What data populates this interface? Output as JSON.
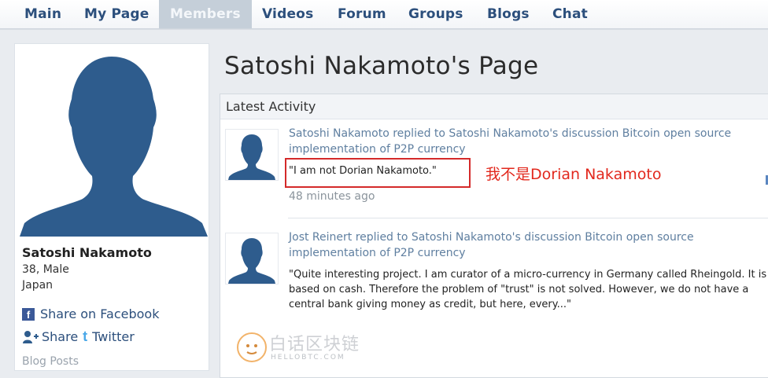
{
  "nav": {
    "items": [
      "Main",
      "My Page",
      "Members",
      "Videos",
      "Forum",
      "Groups",
      "Blogs",
      "Chat"
    ],
    "active": "Members"
  },
  "profile": {
    "name": "Satoshi Nakamoto",
    "age_gender": "38, Male",
    "location": "Japan",
    "share_facebook": "Share on Facebook",
    "share_label": "Share",
    "twitter_label": "Twitter",
    "blog_posts": "Blog Posts"
  },
  "page": {
    "title": "Satoshi Nakamoto's Page"
  },
  "activity": {
    "header": "Latest Activity",
    "items": [
      {
        "summary": "Satoshi Nakamoto replied to Satoshi Nakamoto's discussion Bitcoin open source implementation of P2P currency",
        "quote": "\"I am not Dorian Nakamoto.\"",
        "time": "48 minutes ago"
      },
      {
        "summary": "Jost Reinert replied to Satoshi Nakamoto's discussion Bitcoin open source implementation of P2P currency",
        "quote": "\"Quite interesting project. I am curator of a micro-currency in Germany called Rheingold. It is based on cash. Therefore the problem of \"trust\" is not solved. However, we do not have a central bank giving money as credit, but here, every...\""
      }
    ]
  },
  "annotation": {
    "text": "我不是Dorian Nakamoto",
    "color": "#e2281d"
  },
  "watermark": {
    "text": "白话区块链",
    "sub": "HELLOBTC.COM"
  },
  "colors": {
    "nav_text": "#2c4f7c",
    "silhouette": "#2e5c8d",
    "link": "#5f7fa0",
    "highlight_border": "#d42a2a"
  }
}
